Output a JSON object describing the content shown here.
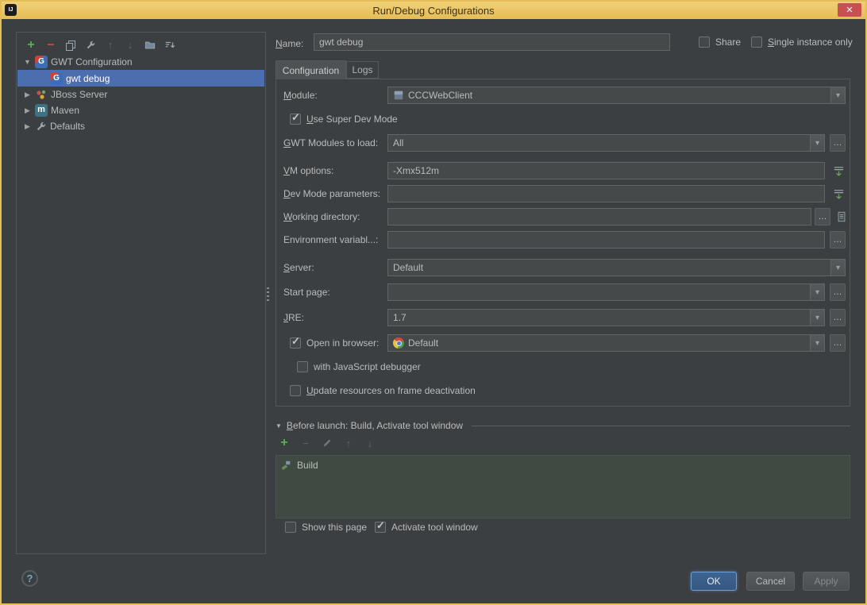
{
  "titlebar": {
    "title": "Run/Debug Configurations"
  },
  "icons": {
    "logo": "IJ",
    "close": "✕",
    "dropdown": "▾",
    "dots": "…",
    "check": "✓",
    "tree_expanded": "▼",
    "tree_collapsed": "▶",
    "section_arrow": "▼",
    "help": "?",
    "plus": "+",
    "minus": "−",
    "arrow_up": "↑",
    "arrow_down": "↓",
    "gwt_letter": "G",
    "maven_letter": "m"
  },
  "tree": {
    "items": [
      {
        "label": "GWT Configuration"
      },
      {
        "label": "gwt debug"
      },
      {
        "label": "JBoss Server"
      },
      {
        "label": "Maven"
      },
      {
        "label": "Defaults"
      }
    ]
  },
  "header": {
    "name_label": "Name:",
    "name_value": "gwt debug",
    "share": "Share",
    "single_instance": "Single instance only"
  },
  "tabs": {
    "configuration": "Configuration",
    "logs": "Logs"
  },
  "form": {
    "module": {
      "label": "Module:",
      "value": "CCCWebClient"
    },
    "use_super_dev_mode": {
      "label": "Use Super Dev Mode",
      "checked": true
    },
    "gwt_modules": {
      "label": "GWT Modules to load:",
      "value": "All"
    },
    "vm_options": {
      "label": "VM options:",
      "value": "-Xmx512m"
    },
    "dev_mode_params": {
      "label": "Dev Mode parameters:",
      "value": ""
    },
    "working_directory": {
      "label": "Working directory:",
      "value": ""
    },
    "environment_variables": {
      "label": "Environment variabl...:",
      "value": ""
    },
    "server": {
      "label": "Server:",
      "value": "Default"
    },
    "start_page": {
      "label": "Start page:",
      "value": ""
    },
    "jre": {
      "label": "JRE:",
      "value": "1.7"
    },
    "open_in_browser": {
      "label": "Open in browser:",
      "value": "Default",
      "checked": true
    },
    "js_debugger": {
      "label": "with JavaScript debugger",
      "checked": false
    },
    "update_resources": {
      "label": "Update resources on frame deactivation",
      "checked": false
    }
  },
  "before_launch": {
    "title": "Before launch: Build, Activate tool window",
    "items": [
      {
        "label": "Build"
      }
    ],
    "show_this_page": {
      "label": "Show this page",
      "checked": false
    },
    "activate_tool_window": {
      "label": "Activate tool window",
      "checked": true
    }
  },
  "footer": {
    "ok": "OK",
    "cancel": "Cancel",
    "apply": "Apply"
  },
  "colors": {
    "accent_selection": "#4b6eaf",
    "titlebar": "#e9c25d",
    "ok_button": "#365880",
    "close_button": "#c75050"
  }
}
